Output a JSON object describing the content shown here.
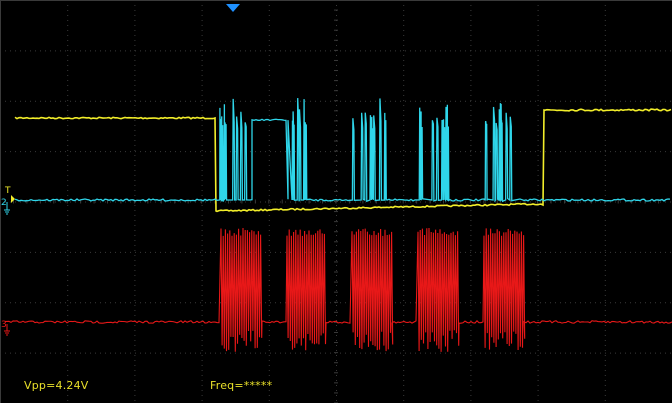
{
  "colors": {
    "background": "#000000",
    "grid": "#3a3a3a",
    "ch1": "#f2ee2a",
    "ch2": "#2fd6ea",
    "ch3": "#e81818",
    "trigger_marker": "#1e90ff",
    "readout_text": "#e9e02a"
  },
  "markers": {
    "trigger_position_icon": "down-triangle",
    "trigger_level_label": "T",
    "ch2_label": "2",
    "ch3_label": "3"
  },
  "measurements": {
    "vpp": "Vpp=4.24V",
    "freq": "Freq=*****"
  }
}
